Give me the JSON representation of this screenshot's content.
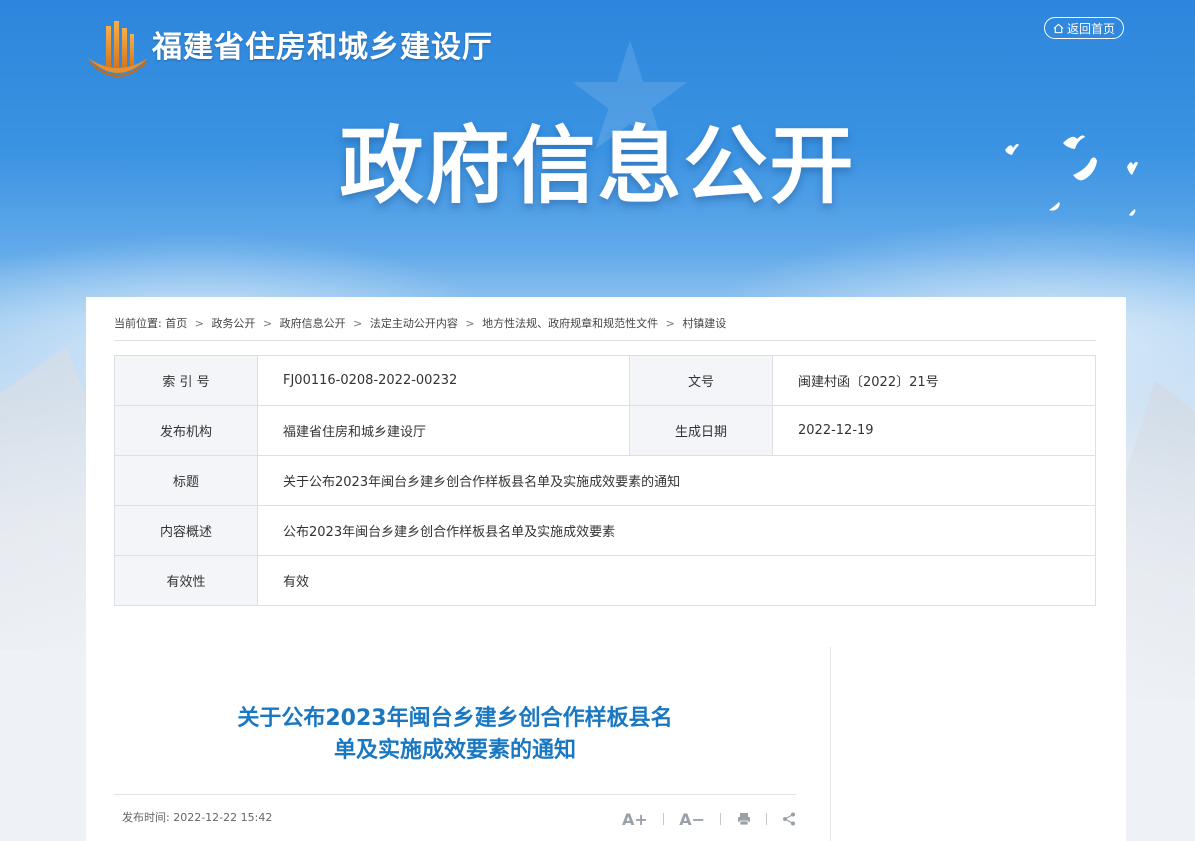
{
  "header": {
    "site_name": "福建省住房和城乡建设厅",
    "home_button": "返回首页",
    "hero_title": "政府信息公开"
  },
  "breadcrumb": {
    "prefix": "当前位置:",
    "items": [
      "首页",
      "政务公开",
      "政府信息公开",
      "法定主动公开内容",
      "地方性法规、政府规章和规范性文件",
      "村镇建设"
    ]
  },
  "info": {
    "index_label": "索 引 号",
    "index_value": "FJ00116-0208-2022-00232",
    "doc_no_label": "文号",
    "doc_no_value": "闽建村函〔2022〕21号",
    "publisher_label": "发布机构",
    "publisher_value": "福建省住房和城乡建设厅",
    "date_label": "生成日期",
    "date_value": "2022-12-19",
    "title_label": "标题",
    "title_value": "关于公布2023年闽台乡建乡创合作样板县名单及实施成效要素的通知",
    "summary_label": "内容概述",
    "summary_value": "公布2023年闽台乡建乡创合作样板县名单及实施成效要素",
    "validity_label": "有效性",
    "validity_value": "有效"
  },
  "article": {
    "title_line1": "关于公布2023年闽台乡建乡创合作样板县名",
    "title_line2": "单及实施成效要素的通知",
    "publish_time_label": "发布时间:",
    "publish_time_value": "2022-12-22 15:42",
    "tools": {
      "font_increase": "A+",
      "font_decrease": "A−"
    }
  },
  "colors": {
    "banner_blue": "#2d86dc",
    "article_title": "#1a78c2",
    "logo_orange": "#e8902a"
  }
}
